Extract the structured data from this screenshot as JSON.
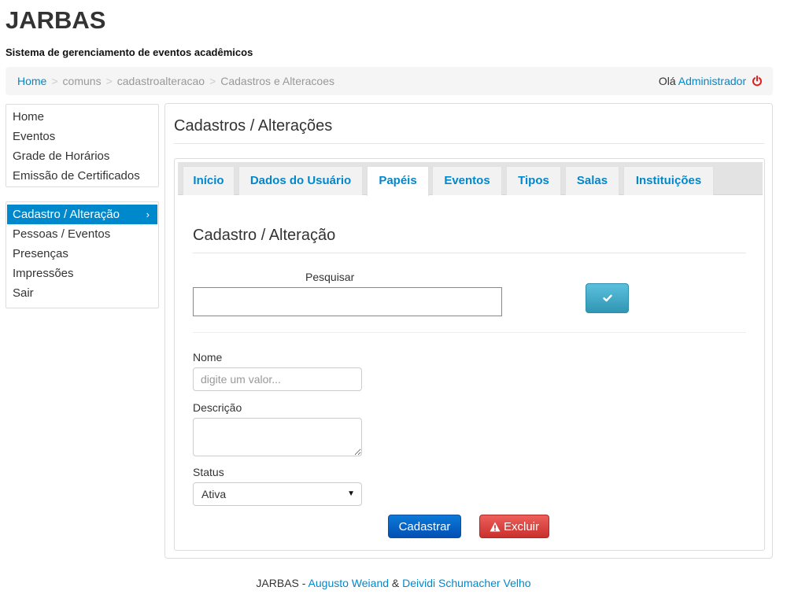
{
  "app": {
    "title": "JARBAS",
    "subtitle": "Sistema de gerenciamento de eventos acadêmicos"
  },
  "breadcrumb": {
    "home": "Home",
    "sep": ">",
    "item2": "comuns",
    "item3": "cadastroalteracao",
    "item4": "Cadastros e Alteracoes"
  },
  "user": {
    "greeting": "Olá",
    "name": "Administrador",
    "logout_icon": "power-icon"
  },
  "sidebar": {
    "group1": [
      "Home",
      "Eventos",
      "Grade de Horários",
      "Emissão de Certificados"
    ],
    "group2": [
      "Cadastro / Alteração",
      "Pessoas / Eventos",
      "Presenças",
      "Impressões",
      "Sair"
    ],
    "active_item": "Cadastro / Alteração",
    "active_chevron": "›"
  },
  "main": {
    "page_title": "Cadastros / Alterações",
    "tabs": [
      "Início",
      "Dados do Usuário",
      "Papéis",
      "Eventos",
      "Tipos",
      "Salas",
      "Instituições"
    ],
    "active_tab": "Papéis"
  },
  "form": {
    "section_title": "Cadastro / Alteração",
    "search_label": "Pesquisar",
    "search_value": "",
    "confirm_icon": "check-icon",
    "nome_label": "Nome",
    "nome_placeholder": "digite um valor...",
    "descricao_label": "Descrição",
    "status_label": "Status",
    "status_value": "Ativa",
    "submit_label": "Cadastrar",
    "delete_label": "Excluir",
    "delete_icon": "warning-icon"
  },
  "footer": {
    "app": "JARBAS",
    "dash": " - ",
    "author1": "Augusto Weiand",
    "amp": " & ",
    "author2": "Deividi Schumacher Velho"
  },
  "colors": {
    "link": "#0088cc",
    "active_nav": "#0088cc",
    "primary": "#0a7ad8",
    "danger": "#ee5f5b",
    "info": "#5bc0de",
    "logout": "#e02020"
  }
}
